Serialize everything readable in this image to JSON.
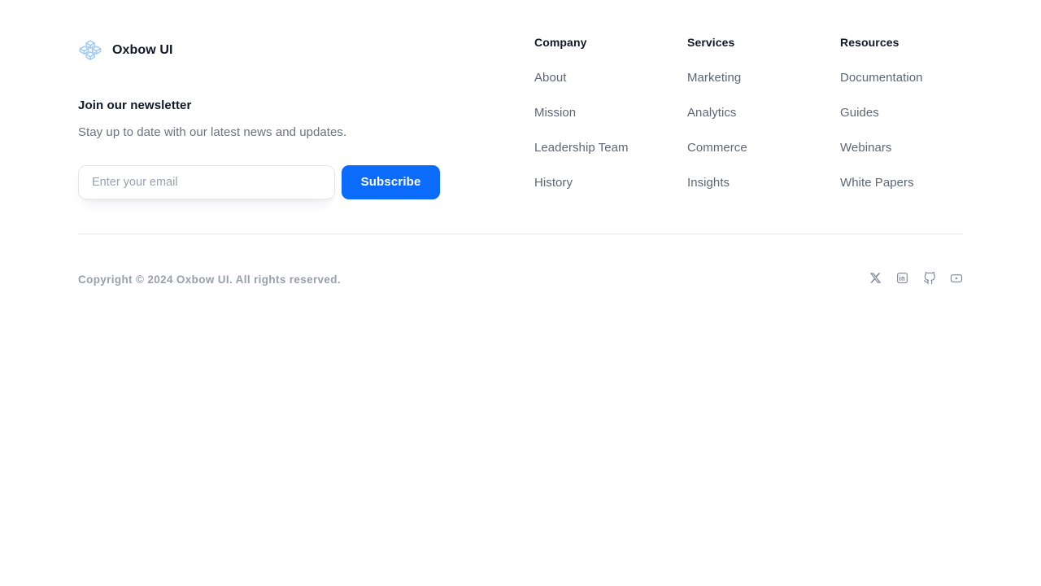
{
  "brand": {
    "name": "Oxbow UI",
    "logo_icon": "stacked-cubes-icon",
    "logo_color": "#9ec9f7"
  },
  "newsletter": {
    "title": "Join our newsletter",
    "subtitle": "Stay up to date with our latest news and updates.",
    "email_placeholder": "Enter your email",
    "email_value": "",
    "submit_label": "Subscribe",
    "accent_color": "#0b6bfb"
  },
  "link_columns": [
    {
      "title": "Company",
      "links": [
        "About",
        "Mission",
        "Leadership Team",
        "History"
      ]
    },
    {
      "title": "Services",
      "links": [
        "Marketing",
        "Analytics",
        "Commerce",
        "Insights"
      ]
    },
    {
      "title": "Resources",
      "links": [
        "Documentation",
        "Guides",
        "Webinars",
        "White Papers"
      ]
    }
  ],
  "bottom": {
    "copyright": "Copyright © 2024 Oxbow UI. All rights reserved.",
    "socials": [
      {
        "name": "X",
        "icon": "x-twitter-icon"
      },
      {
        "name": "LinkedIn",
        "icon": "linkedin-icon"
      },
      {
        "name": "GitHub",
        "icon": "github-icon"
      },
      {
        "name": "YouTube",
        "icon": "youtube-icon"
      }
    ],
    "text_color": "#98a0ac",
    "icon_color": "#7c869a"
  }
}
